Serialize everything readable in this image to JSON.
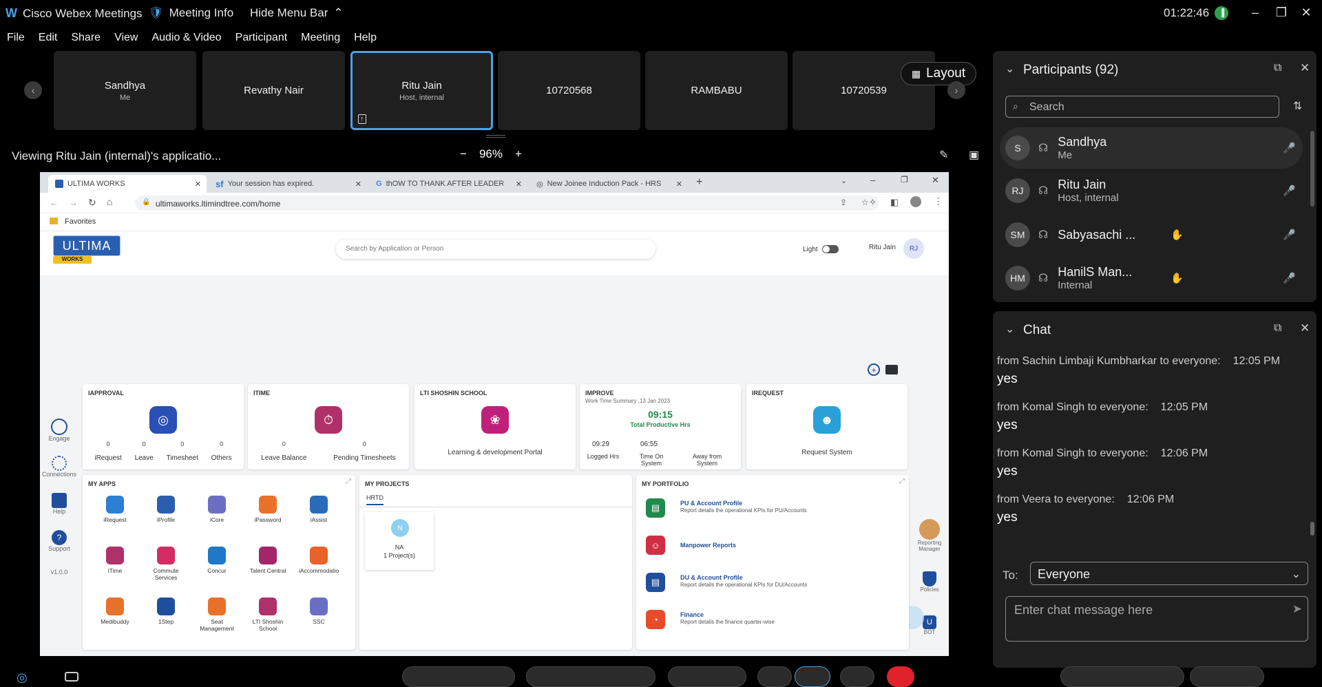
{
  "titlebar": {
    "app_name": "Cisco Webex Meetings",
    "meeting_info": "Meeting Info",
    "hide_menu": "Hide Menu Bar",
    "time": "01:22:46"
  },
  "menu": [
    "File",
    "Edit",
    "Share",
    "View",
    "Audio & Video",
    "Participant",
    "Meeting",
    "Help"
  ],
  "tiles": [
    {
      "name": "Sandhya",
      "sub": "Me"
    },
    {
      "name": "Revathy Nair",
      "sub": ""
    },
    {
      "name": "Ritu Jain",
      "sub": "Host, internal"
    },
    {
      "name": "10720568",
      "sub": ""
    },
    {
      "name": "RAMBABU",
      "sub": ""
    },
    {
      "name": "10720539",
      "sub": ""
    }
  ],
  "layout_label": "Layout",
  "share_bar": {
    "viewing": "Viewing Ritu Jain (internal)'s applicatio...",
    "zoom": "96%"
  },
  "browser": {
    "tabs": [
      "ULTIMA WORKS",
      "Your session has expired.",
      "thOW TO THANK AFTER LEADER",
      "New Joinee Induction Pack - HRS"
    ],
    "url": "ultimaworks.ltimindtree.com/home",
    "favorites": "Favorites"
  },
  "app": {
    "logo": "ULTIMA",
    "logo_sub": "WORKS",
    "search_placeholder": "Search by Application or Person",
    "theme_label": "Light",
    "user_name": "Ritu Jain",
    "user_initials": "RJ",
    "version": "v1.0.0",
    "side_nav": [
      "Engage",
      "Connections",
      "Help",
      "Support"
    ],
    "right_nav": [
      "Reporting Manager",
      "Policies",
      "BOT"
    ],
    "approval": {
      "title": "IAPPROVAL",
      "counts": [
        "0",
        "0",
        "0",
        "0"
      ],
      "labels": [
        "iRequest",
        "Leave",
        "Timesheet",
        "Others"
      ]
    },
    "itime": {
      "title": "ITIME",
      "counts": [
        "0",
        "0"
      ],
      "labels": [
        "Leave Balance",
        "Pending Timesheets"
      ]
    },
    "school": {
      "title": "LTI SHOSHIN SCHOOL",
      "caption": "Learning & development Portal"
    },
    "improve": {
      "title": "IMPROVE",
      "summary": "Work Time Summary ,13 Jan 2023",
      "hours": "09:15",
      "hours_label": "Total Productive Hrs",
      "logged": "09:29",
      "on_system": "06:55",
      "logged_label": "Logged Hrs",
      "on_label": "Time On System",
      "away_label": "Away from System"
    },
    "irequest": {
      "title": "IREQUEST",
      "caption": "Request System"
    },
    "my_apps": {
      "title": "MY APPS",
      "items": [
        {
          "label": "iRequest",
          "color": "#2d7fd3"
        },
        {
          "label": "iProfile",
          "color": "#2a5fb0"
        },
        {
          "label": "iCore",
          "color": "#6b6fc4"
        },
        {
          "label": "iPassword",
          "color": "#e8722a"
        },
        {
          "label": "iAssist",
          "color": "#2a6cb8"
        },
        {
          "label": "iTime",
          "color": "#b0306a"
        },
        {
          "label": "Commute Services",
          "color": "#d12d64"
        },
        {
          "label": "Concur",
          "color": "#1f78c8"
        },
        {
          "label": "Talent Central",
          "color": "#a3266a"
        },
        {
          "label": "iAccommodatio",
          "color": "#e8622a"
        },
        {
          "label": "Medibuddy",
          "color": "#e8722a"
        },
        {
          "label": "1Step",
          "color": "#1f4f9c"
        },
        {
          "label": "Seat Management",
          "color": "#e8722a"
        },
        {
          "label": "LTI Shoshin School",
          "color": "#b0306a"
        },
        {
          "label": "SSC",
          "color": "#6b6fc4"
        }
      ]
    },
    "my_projects": {
      "title": "MY PROJECTS",
      "tab": "HRTD",
      "initial": "N",
      "name": "NA",
      "count": "1 Project(s)"
    },
    "my_portfolio": {
      "title": "MY PORTFOLIO",
      "items": [
        {
          "title": "PU & Account Profile",
          "desc": "Report details the operational KPIs for PU/Accounts",
          "color": "#1f8a4c"
        },
        {
          "title": "Manpower Reports",
          "desc": "",
          "color": "#d12d44"
        },
        {
          "title": "DU & Account Profile",
          "desc": "Report details the operational KPIs for DU/Accounts",
          "color": "#1f4f9c"
        },
        {
          "title": "Finance",
          "desc": "Report details the finance quarter-wise",
          "color": "#e84a2a"
        }
      ]
    }
  },
  "participants": {
    "title": "Participants (92)",
    "search_placeholder": "Search",
    "list": [
      {
        "initials": "S",
        "name": "Sandhya",
        "sub": "Me"
      },
      {
        "initials": "RJ",
        "name": "Ritu Jain",
        "sub": "Host, internal"
      },
      {
        "initials": "SM",
        "name": "Sabyasachi ...",
        "sub": ""
      },
      {
        "initials": "HM",
        "name": "HanilS Man...",
        "sub": "Internal"
      }
    ]
  },
  "chat": {
    "title": "Chat",
    "messages": [
      {
        "from": "from Sachin Limbaji Kumbharkar to everyone:",
        "time": "12:05 PM",
        "text": "yes"
      },
      {
        "from": "from Komal Singh to everyone:",
        "time": "12:05 PM",
        "text": "yes"
      },
      {
        "from": "from Komal Singh to everyone:",
        "time": "12:06 PM",
        "text": "yes"
      },
      {
        "from": "from Veera to everyone:",
        "time": "12:06 PM",
        "text": "yes"
      }
    ],
    "to_label": "To:",
    "to_value": "Everyone",
    "input_placeholder": "Enter chat message here"
  },
  "colors": {
    "accent": "#4aa3e8",
    "end_call": "#e0232b"
  }
}
